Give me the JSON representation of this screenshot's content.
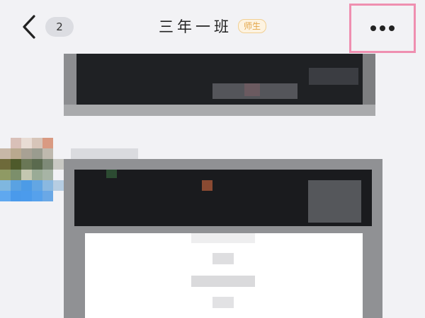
{
  "navbar": {
    "back_icon": "chevron-left-icon",
    "unread_count": "2",
    "title": "三年一班",
    "role_tag": "师生",
    "more_icon": "more-horizontal-icon",
    "highlight_color": "#ef8fb0"
  },
  "content": {
    "note": ""
  }
}
